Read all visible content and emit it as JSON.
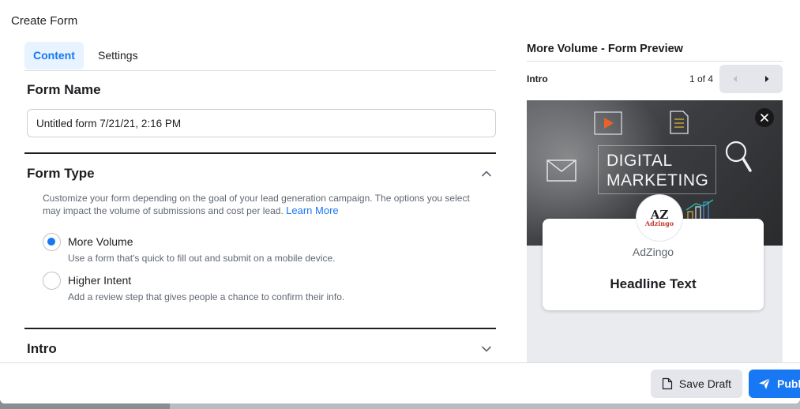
{
  "modal": {
    "title": "Create Form"
  },
  "tabs": [
    {
      "label": "Content",
      "active": true
    },
    {
      "label": "Settings",
      "active": false
    }
  ],
  "form_name": {
    "heading": "Form Name",
    "value": "Untitled form 7/21/21, 2:16 PM"
  },
  "form_type": {
    "heading": "Form Type",
    "description": "Customize your form depending on the goal of your lead generation campaign. The options you select may impact the volume of submissions and cost per lead.",
    "learn_more": "Learn More",
    "options": [
      {
        "label": "More Volume",
        "sub": "Use a form that's quick to fill out and submit on a mobile device.",
        "selected": true
      },
      {
        "label": "Higher Intent",
        "sub": "Add a review step that gives people a chance to confirm their info.",
        "selected": false
      }
    ]
  },
  "intro": {
    "heading": "Intro"
  },
  "preview": {
    "title": "More Volume - Form Preview",
    "step": "Intro",
    "count": "1 of 4",
    "hero_text_line1": "DIGITAL",
    "hero_text_line2": "MARKETING",
    "logo_mark": "AZ",
    "logo_text": "Adzingo",
    "brand": "AdZingo",
    "headline": "Headline Text"
  },
  "footer": {
    "save_label": "Save Draft",
    "publish_label": "Publ"
  },
  "colors": {
    "accent": "#1877f2",
    "tab_active_bg": "#e7f3ff",
    "secondary_button_bg": "#e4e6eb"
  }
}
